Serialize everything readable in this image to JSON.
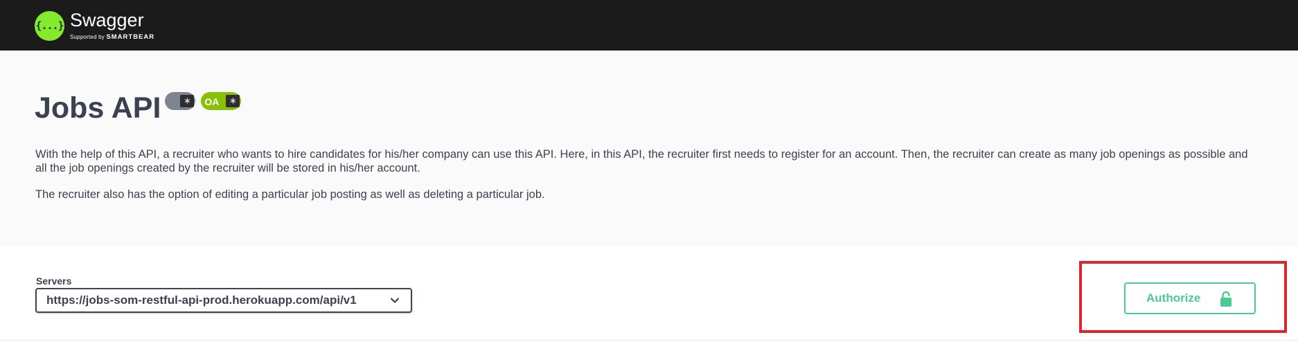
{
  "topbar": {
    "logo_glyph": "{...}",
    "brand_name": "Swagger",
    "supported_by": "Supported by",
    "smartbear": "SMARTBEAR"
  },
  "info": {
    "title": "Jobs API",
    "badges": {
      "oas_text": "OA"
    },
    "description": [
      "With the help of this API, a recruiter who wants to hire candidates for his/her company can use this API. Here, in this API, the recruiter first needs to register for an account. Then, the recruiter can create as many job openings as possible and all the job openings created by the recruiter will be stored in his/her account.",
      "The recruiter also has the option of editing a particular job posting as well as deleting a particular job."
    ]
  },
  "servers": {
    "label": "Servers",
    "selected": "https://jobs-som-restful-api-prod.herokuapp.com/api/v1"
  },
  "authorize": {
    "label": "Authorize",
    "icon": "lock-icon",
    "color": "#49cc90",
    "highlight_color": "#e0242b"
  },
  "colors": {
    "topbar": "#1b1b1b",
    "logo": "#85ea2d",
    "info_bg": "#fafafa",
    "text": "#3b4151"
  }
}
